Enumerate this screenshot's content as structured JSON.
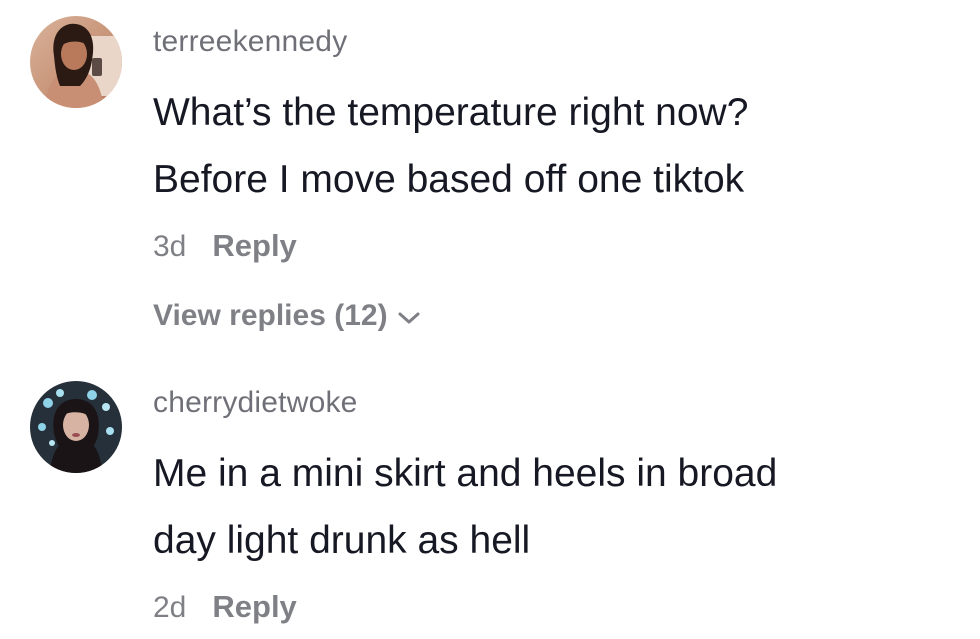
{
  "comments": [
    {
      "username": "terreekennedy",
      "text_lines": [
        "What’s the temperature right now?",
        "Before I move based off one tiktok"
      ],
      "time": "3d",
      "reply_label": "Reply",
      "view_replies_label": "View replies (12)"
    },
    {
      "username": "cherrydietwoke",
      "text_lines": [
        "Me in a mini skirt and heels in broad",
        "day light drunk as hell"
      ],
      "time": "2d",
      "reply_label": "Reply"
    }
  ],
  "icons": {
    "expand_replies": "chevron-down-icon"
  },
  "colors": {
    "text_primary": "#161823",
    "text_secondary": "#8a8b91",
    "background": "#ffffff"
  }
}
